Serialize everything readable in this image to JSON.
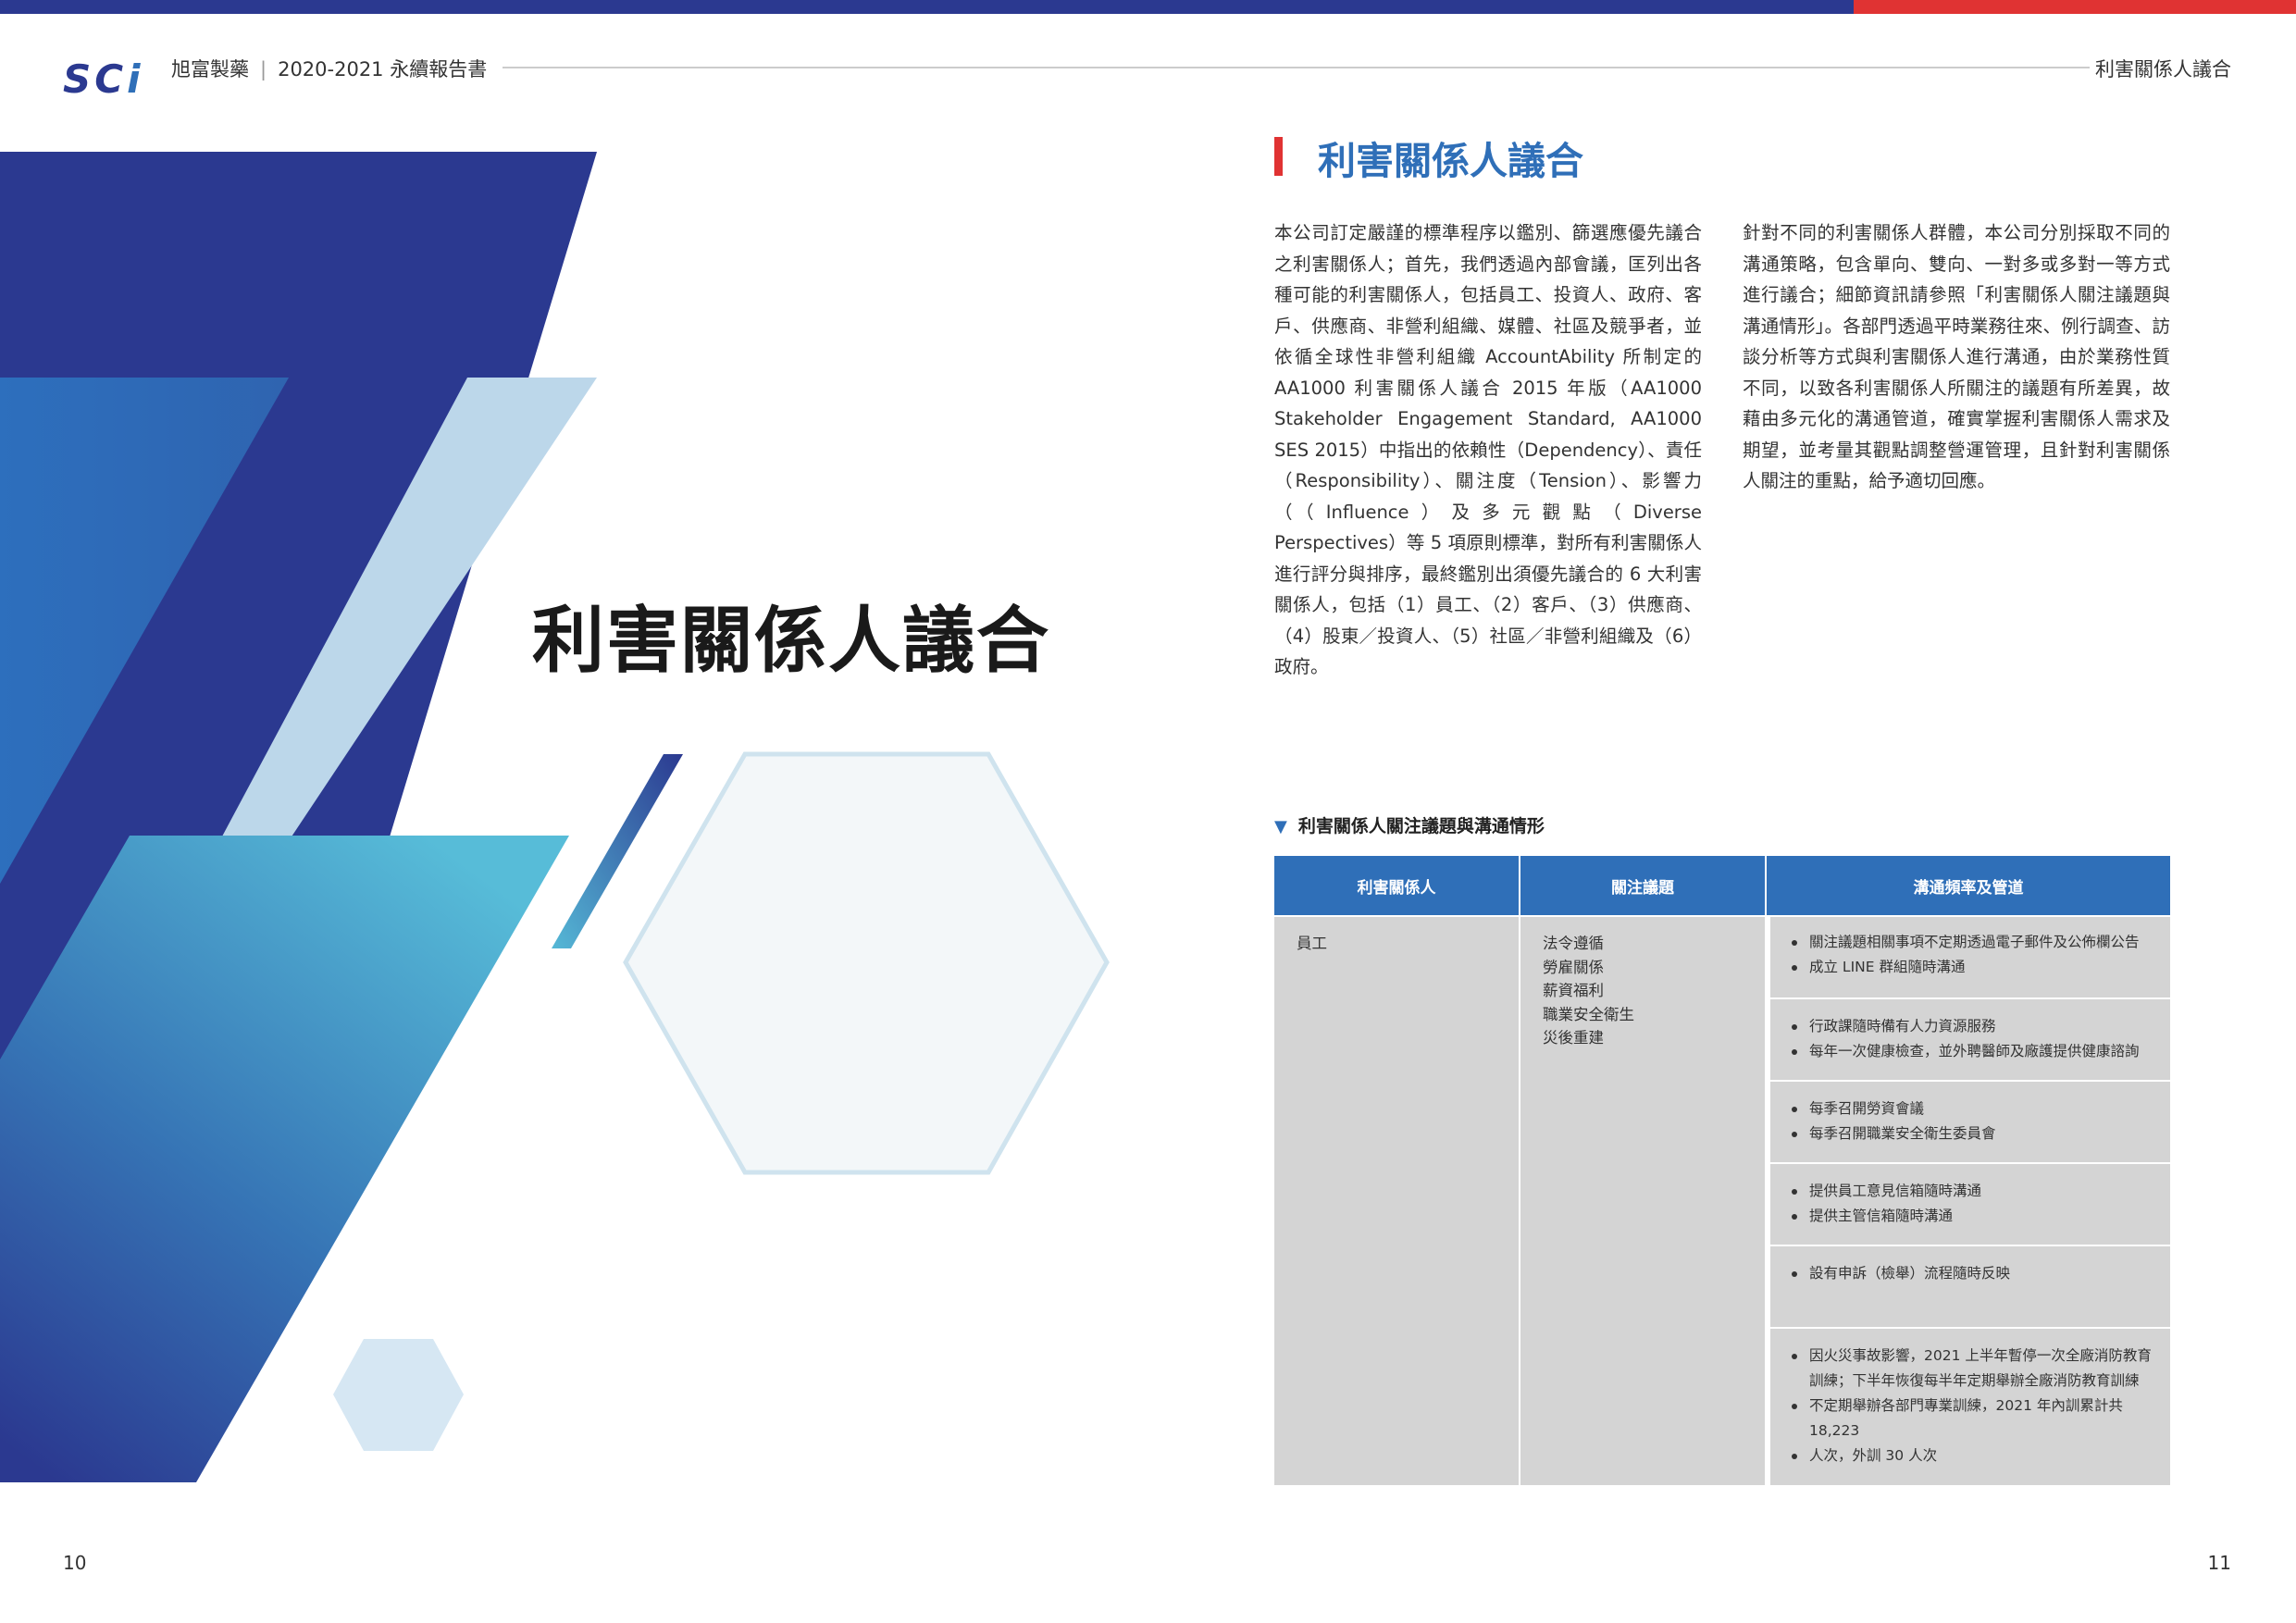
{
  "header": {
    "logo_text": "SC",
    "logo_text_i": "i",
    "company": "旭富製藥",
    "separator": "|",
    "report": "2020-2021 永續報告書",
    "section": "利害關係人議合"
  },
  "cover": {
    "title": "利害關係人議合"
  },
  "section": {
    "title": "利害關係人議合",
    "paragraph1": "本公司訂定嚴謹的標準程序以鑑別、篩選應優先議合之利害關係人；首先，我們透過內部會議，匡列出各種可能的利害關係人，包括員工、投資人、政府、客戶、供應商、非營利組織、媒體、社區及競爭者，並依循全球性非營利組織 AccountAbility 所制定的 AA1000 利害關係人議合 2015 年版（AA1000 Stakeholder Engagement Standard, AA1000 SES 2015）中指出的依賴性（Dependency）、責任（Responsibility）、關注度（Tension）、影響力（（Influence）及多元觀點（Diverse Perspectives）等 5 項原則標準，對所有利害關係人進行評分與排序，最終鑑別出須優先議合的 6 大利害關係人，包括（1）員工、（2）客戶、（3）供應商、（4）股東／投資人、（5）社區／非營利組織及（6）政府。",
    "paragraph2": "針對不同的利害關係人群體，本公司分別採取不同的溝通策略，包含單向、雙向、一對多或多對一等方式進行議合；細節資訊請參照「利害關係人關注議題與溝通情形」。各部門透過平時業務往來、例行調查、訪談分析等方式與利害關係人進行溝通，由於業務性質不同，以致各利害關係人所關注的議題有所差異，故藉由多元化的溝通管道，確實掌握利害關係人需求及期望，並考量其觀點調整營運管理，且針對利害關係人關注的重點，給予適切回應。"
  },
  "table": {
    "caption_marker": "▼",
    "caption": "利害關係人關注議題與溝通情形",
    "headers": [
      "利害關係人",
      "關注議題",
      "溝通頻率及管道"
    ],
    "stakeholder": "員工",
    "issues": [
      "法令遵循",
      "勞雇關係",
      "薪資福利",
      "職業安全衛生",
      "災後重建"
    ],
    "channels": [
      [
        "關注議題相關事項不定期透過電子郵件及公佈欄公告",
        "成立 LINE 群組隨時溝通"
      ],
      [
        "行政課隨時備有人力資源服務",
        "每年一次健康檢查，並外聘醫師及廠護提供健康諮詢"
      ],
      [
        "每季召開勞資會議",
        "每季召開職業安全衛生委員會"
      ],
      [
        "提供員工意見信箱隨時溝通",
        "提供主管信箱隨時溝通"
      ],
      [
        "設有申訴（檢舉）流程隨時反映"
      ],
      [
        "因火災事故影響，2021 上半年暫停一次全廠消防教育訓練；下半年恢復每半年定期舉辦全廠消防教育訓練",
        "不定期舉辦各部門專業訓練，2021 年內訓累計共 18,223",
        "人次，外訓 30 人次"
      ]
    ]
  },
  "pages": {
    "left": "10",
    "right": "11"
  },
  "colors": {
    "navy": "#2b3990",
    "blue": "#2f6fb8",
    "light_blue": "#bcd7ea",
    "teal": "#55b8d6",
    "red": "#e03333",
    "table_gray": "#d4d4d4"
  }
}
